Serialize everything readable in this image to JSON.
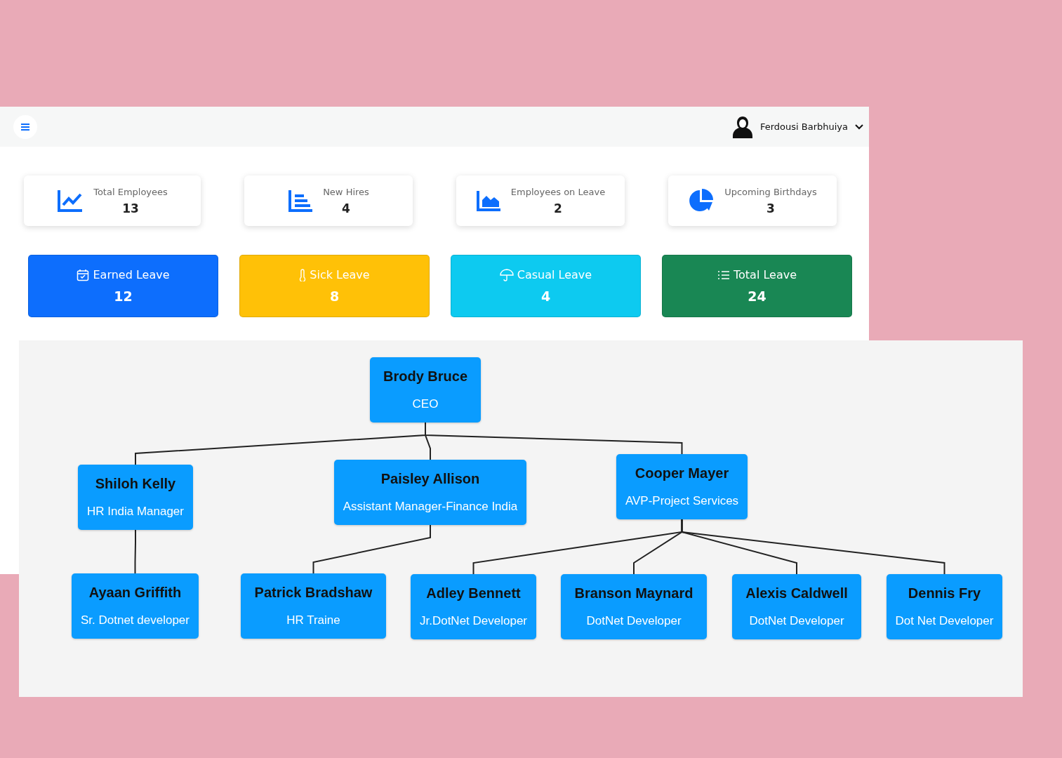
{
  "header": {
    "user_name": "Ferdousi Barbhuiya"
  },
  "stats": [
    {
      "label": "Total Employees",
      "value": "13"
    },
    {
      "label": "New Hires",
      "value": "4"
    },
    {
      "label": "Employees on Leave",
      "value": "2"
    },
    {
      "label": "Upcoming Birthdays",
      "value": "3"
    }
  ],
  "leave_cards": [
    {
      "label": "Earned Leave",
      "value": "12",
      "color": "#0d6efd"
    },
    {
      "label": "Sick Leave",
      "value": "8",
      "color": "#ffc107"
    },
    {
      "label": "Casual Leave",
      "value": "4",
      "color": "#0dcaf0"
    },
    {
      "label": "Total Leave",
      "value": "24",
      "color": "#198754"
    }
  ],
  "org_chart": {
    "root": {
      "name": "Brody Bruce",
      "title": "CEO",
      "children": [
        {
          "name": "Shiloh Kelly",
          "title": "HR India Manager",
          "children": [
            {
              "name": "Ayaan Griffith",
              "title": "Sr. Dotnet developer"
            }
          ]
        },
        {
          "name": "Paisley Allison",
          "title": "Assistant Manager-Finance India",
          "children": [
            {
              "name": "Patrick Bradshaw",
              "title": "HR Traine"
            }
          ]
        },
        {
          "name": "Cooper Mayer",
          "title": "AVP-Project Services",
          "children": [
            {
              "name": "Adley Bennett",
              "title": "Jr.DotNet Developer"
            },
            {
              "name": "Branson Maynard",
              "title": "DotNet Developer"
            },
            {
              "name": "Alexis Caldwell",
              "title": "DotNet Developer"
            },
            {
              "name": "Dennis Fry",
              "title": "Dot Net Developer"
            }
          ]
        }
      ]
    }
  }
}
